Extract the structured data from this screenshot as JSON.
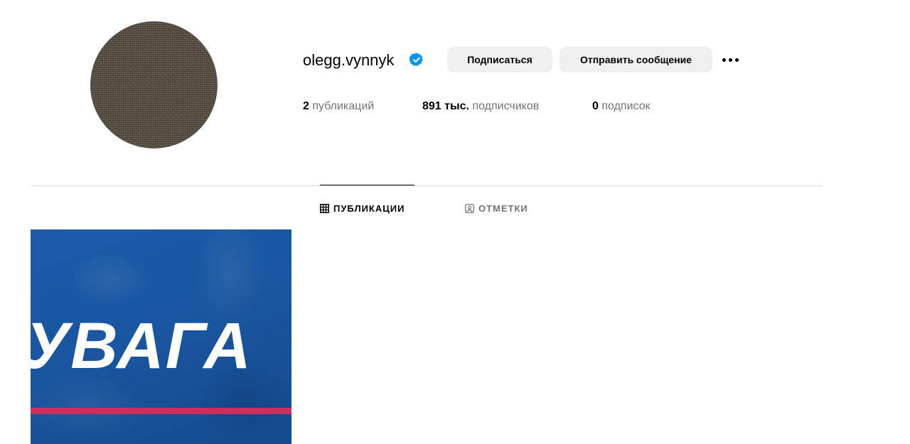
{
  "profile": {
    "username": "olegg.vynnyk",
    "verified": true,
    "follow_label": "Подписаться",
    "message_label": "Отправить сообщение",
    "more_icon": "more-horizontal-icon"
  },
  "stats": {
    "posts_count": "2",
    "posts_label": "публикаций",
    "followers_count": "891 тыс.",
    "followers_label": "подписчиков",
    "following_count": "0",
    "following_label": "подписок"
  },
  "tabs": [
    {
      "label": "ПУБЛИКАЦИИ",
      "icon": "grid-icon",
      "active": true
    },
    {
      "label": "ОТМЕТКИ",
      "icon": "tagged-icon",
      "active": false
    }
  ],
  "posts": [
    {
      "text": "УВАГА"
    }
  ],
  "colors": {
    "verified": "#0095f6",
    "button_bg": "#efefef",
    "muted_text": "#737373",
    "post_bg": "#1a56a1",
    "post_stripe": "#c9305b"
  }
}
